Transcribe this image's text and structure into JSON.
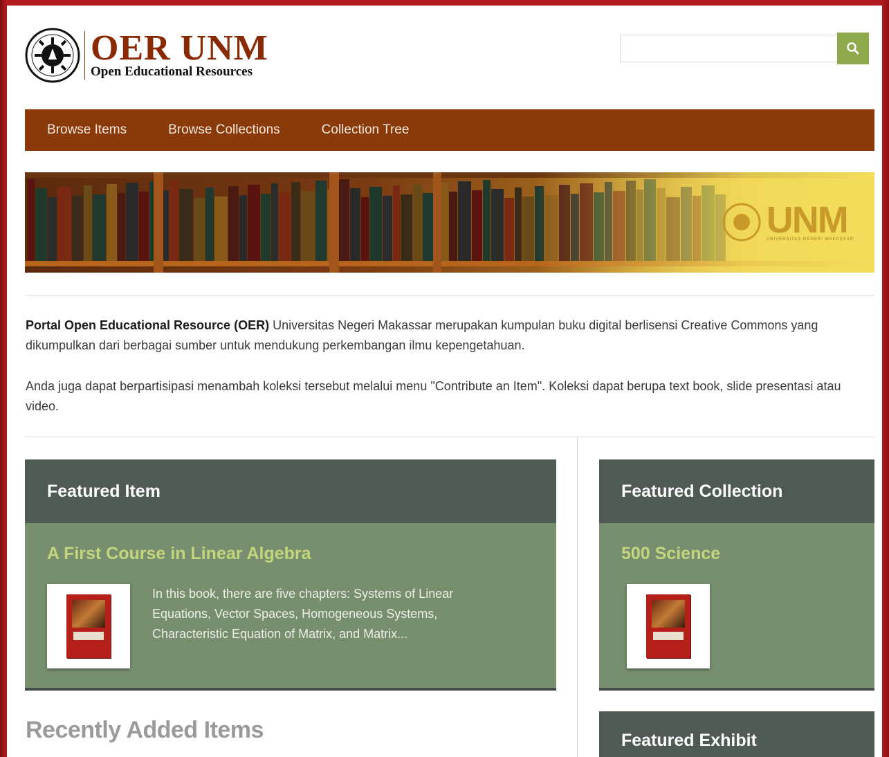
{
  "header": {
    "logo_title": "OER UNM",
    "logo_subtitle": "Open Educational Resources",
    "search_placeholder": ""
  },
  "nav": {
    "items": [
      {
        "label": "Browse Items"
      },
      {
        "label": "Browse Collections"
      },
      {
        "label": "Collection Tree"
      }
    ]
  },
  "banner": {
    "brand": "UNM",
    "sub": "UNIVERSITAS NEGERI MAKASSAR"
  },
  "intro": {
    "bold": "Portal Open Educational Resource (OER)",
    "p1_rest": " Universitas Negeri Makassar merupakan kumpulan buku digital berlisensi Creative Commons yang dikumpulkan dari berbagai sumber untuk mendukung perkembangan ilmu kepengetahuan.",
    "p2": "Anda juga dapat berpartisipasi menambah koleksi tersebut melalui menu \"Contribute an Item\". Koleksi dapat berupa text book, slide presentasi atau video."
  },
  "featured_item": {
    "heading": "Featured Item",
    "title": "A First Course in Linear Algebra",
    "description": "In this book, there are five chapters: Systems of Linear Equations, Vector Spaces, Homogeneous Systems, Characteristic Equation of Matrix, and Matrix..."
  },
  "featured_collection": {
    "heading": "Featured Collection",
    "title": "500 Science"
  },
  "featured_exhibit": {
    "heading": "Featured Exhibit"
  },
  "recent": {
    "heading": "Recently Added Items"
  },
  "colors": {
    "nav_bg": "#8a3a08",
    "panel_head": "#4e5a52",
    "panel_body": "#778e6f",
    "link_green": "#c3d67d",
    "search_btn": "#8faa4c",
    "frame_red": "#b11a1e"
  }
}
